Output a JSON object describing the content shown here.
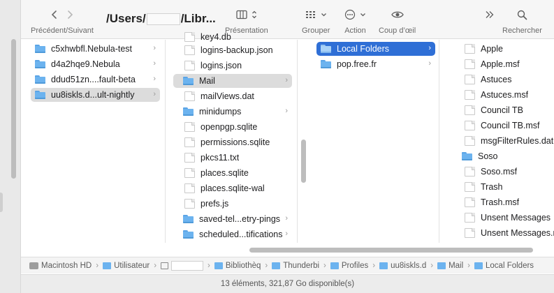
{
  "toolbar": {
    "nav_label": "Précédent/Suivant",
    "path_title_start": "/Users/",
    "path_title_end": "/Libr...",
    "presentation_label": "Présentation",
    "group_label": "Grouper",
    "action_label": "Action",
    "quicklook_label": "Coup d’œil",
    "search_label": "Rechercher"
  },
  "columns": {
    "col1": [
      {
        "name": "c5xhwbfl.Nebula-test",
        "kind": "folder"
      },
      {
        "name": "d4a2hqe9.Nebula",
        "kind": "folder"
      },
      {
        "name": "ddud51zn....fault-beta",
        "kind": "folder"
      },
      {
        "name": "uu8iskls.d...ult-nightly",
        "kind": "folder",
        "selected": true
      }
    ],
    "col2_top_partial": "key4.db",
    "col2": [
      {
        "name": "logins-backup.json",
        "kind": "doc"
      },
      {
        "name": "logins.json",
        "kind": "doc"
      },
      {
        "name": "Mail",
        "kind": "folder",
        "selected": true
      },
      {
        "name": "mailViews.dat",
        "kind": "doc"
      },
      {
        "name": "minidumps",
        "kind": "folder"
      },
      {
        "name": "openpgp.sqlite",
        "kind": "doc"
      },
      {
        "name": "permissions.sqlite",
        "kind": "doc"
      },
      {
        "name": "pkcs11.txt",
        "kind": "doc"
      },
      {
        "name": "places.sqlite",
        "kind": "doc"
      },
      {
        "name": "places.sqlite-wal",
        "kind": "doc"
      },
      {
        "name": "prefs.js",
        "kind": "doc"
      },
      {
        "name": "saved-tel...etry-pings",
        "kind": "folder"
      },
      {
        "name": "scheduled...tifications",
        "kind": "folder"
      }
    ],
    "col3": [
      {
        "name": "Local Folders",
        "kind": "folder",
        "selected": true
      },
      {
        "name": "pop.free.fr",
        "kind": "folder"
      }
    ],
    "col4": [
      {
        "name": "Apple",
        "kind": "doc"
      },
      {
        "name": "Apple.msf",
        "kind": "doc"
      },
      {
        "name": "Astuces",
        "kind": "doc"
      },
      {
        "name": "Astuces.msf",
        "kind": "doc"
      },
      {
        "name": "Council TB",
        "kind": "doc"
      },
      {
        "name": "Council TB.msf",
        "kind": "doc"
      },
      {
        "name": "msgFilterRules.dat",
        "kind": "doc"
      },
      {
        "name": "Soso",
        "kind": "folder"
      },
      {
        "name": "Soso.msf",
        "kind": "doc"
      },
      {
        "name": "Trash",
        "kind": "doc"
      },
      {
        "name": "Trash.msf",
        "kind": "doc"
      },
      {
        "name": "Unsent Messages",
        "kind": "doc"
      },
      {
        "name": "Unsent Messages.r",
        "kind": "doc"
      }
    ]
  },
  "pathbar": {
    "disk": "Macintosh HD",
    "users": "Utilisateur",
    "library": "Bibliothèq",
    "thunderbird": "Thunderbi",
    "profiles": "Profiles",
    "profile": "uu8iskls.d",
    "mail": "Mail",
    "local": "Local Folders"
  },
  "status": {
    "text": "13 éléments, 321,87 Go disponible(s)"
  },
  "colors": {
    "selection_blue": "#2f6fd6",
    "selection_gray": "#dcdcdc",
    "folder_blue": "#6cb3ef"
  }
}
